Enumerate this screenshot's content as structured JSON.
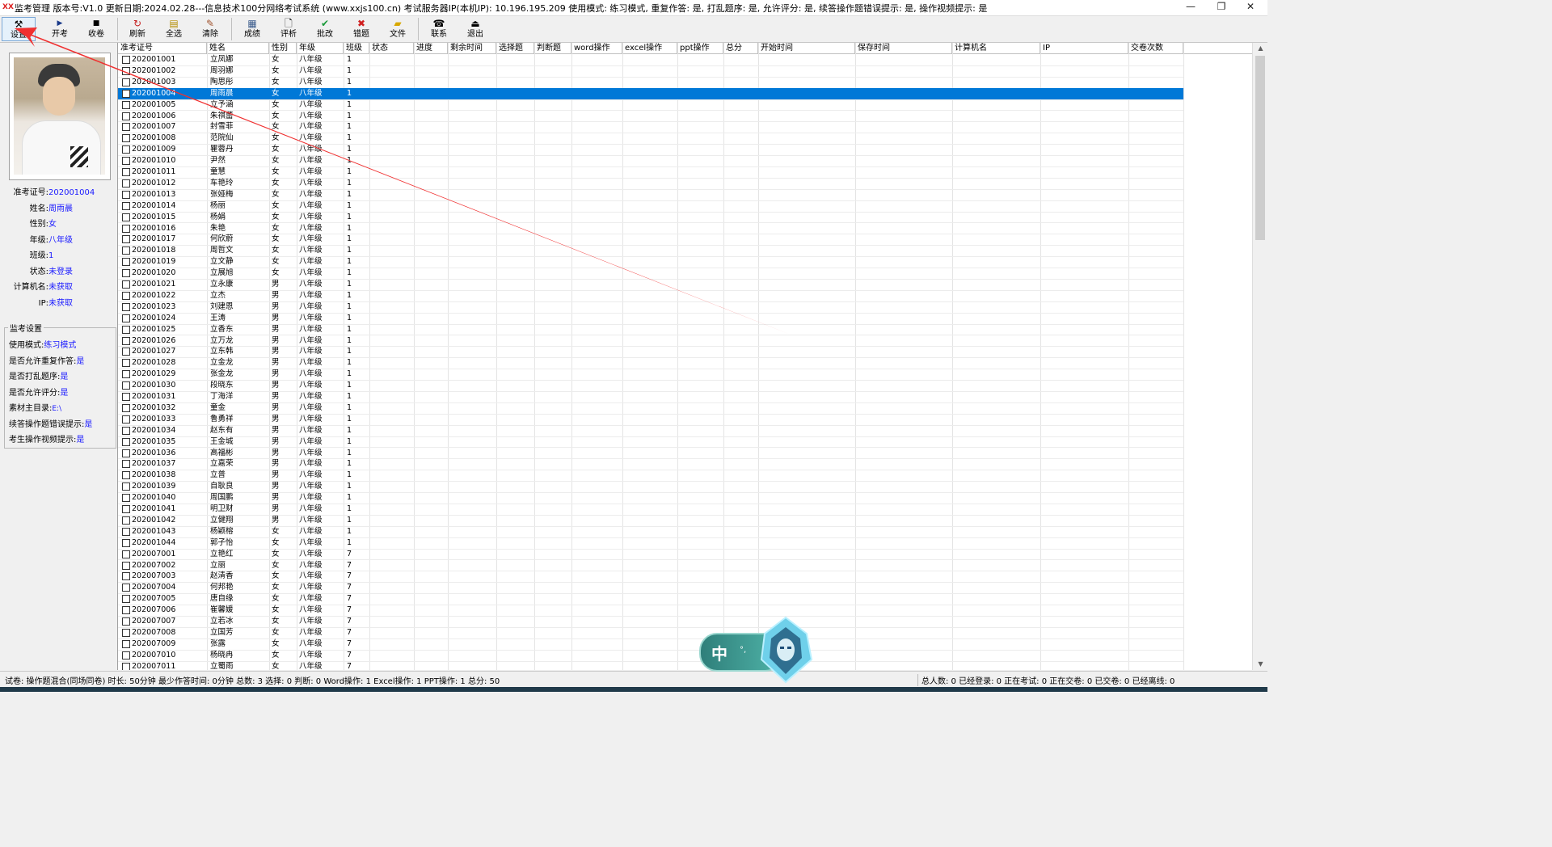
{
  "window": {
    "title": "监考管理 版本号:V1.0 更新日期:2024.02.28---信息技术100分网络考试系统    (www.xxjs100.cn)          考试服务器IP(本机IP): 10.196.195.209    使用模式: 练习模式, 重复作答: 是, 打乱题序: 是, 允许评分: 是, 续答操作题错误提示: 是, 操作视频提示: 是",
    "controls": [
      "—",
      "❐",
      "✕"
    ]
  },
  "toolbar": {
    "buttons": [
      {
        "label": "设置",
        "icon": "tools-icon"
      },
      {
        "label": "开考",
        "icon": "play-icon"
      },
      {
        "label": "收卷",
        "icon": "stop-icon"
      },
      {
        "label": "刷新",
        "icon": "refresh-icon"
      },
      {
        "label": "全选",
        "icon": "select-all-icon"
      },
      {
        "label": "清除",
        "icon": "eraser-icon"
      },
      {
        "label": "成绩",
        "icon": "scores-icon"
      },
      {
        "label": "评析",
        "icon": "analysis-icon"
      },
      {
        "label": "批改",
        "icon": "check-icon"
      },
      {
        "label": "错题",
        "icon": "wrong-icon"
      },
      {
        "label": "文件",
        "icon": "folder-icon"
      },
      {
        "label": "联系",
        "icon": "phone-icon"
      },
      {
        "label": "退出",
        "icon": "exit-icon"
      }
    ]
  },
  "student": {
    "fields": [
      {
        "key": "准考证号:",
        "value": "202001004"
      },
      {
        "key": "姓名:",
        "value": "周雨晨"
      },
      {
        "key": "性别:",
        "value": "女"
      },
      {
        "key": "年级:",
        "value": "八年级"
      },
      {
        "key": "班级:",
        "value": "1"
      },
      {
        "key": "状态:",
        "value": "未登录"
      },
      {
        "key": "计算机名:",
        "value": "未获取"
      },
      {
        "key": "IP:",
        "value": "未获取"
      }
    ]
  },
  "settings": {
    "title": "监考设置",
    "rows": [
      {
        "key": "使用模式:",
        "value": "练习模式"
      },
      {
        "key": "是否允许重复作答:",
        "value": "是"
      },
      {
        "key": "是否打乱题序:",
        "value": "是"
      },
      {
        "key": "是否允许评分:",
        "value": "是"
      },
      {
        "key": "素材主目录:",
        "value": "E:\\"
      },
      {
        "key": "续答操作题错误提示:",
        "value": "是"
      },
      {
        "key": "考生操作视频提示:",
        "value": "是"
      }
    ]
  },
  "grid": {
    "columns": [
      "准考证号",
      "姓名",
      "性别",
      "年级",
      "班级",
      "状态",
      "进度",
      "剩余时间",
      "选择题",
      "判断题",
      "word操作",
      "excel操作",
      "ppt操作",
      "总分",
      "开始时间",
      "保存时间",
      "计算机名",
      "IP",
      "交卷次数"
    ],
    "selected_index": 3,
    "rows": [
      [
        "202001001",
        "立凤娜",
        "女",
        "八年级",
        "1"
      ],
      [
        "202001002",
        "周羽娜",
        "女",
        "八年级",
        "1"
      ],
      [
        "202001003",
        "陶思彤",
        "女",
        "八年级",
        "1"
      ],
      [
        "202001004",
        "周雨晨",
        "女",
        "八年级",
        "1"
      ],
      [
        "202001005",
        "立予涵",
        "女",
        "八年级",
        "1"
      ],
      [
        "202001006",
        "朱祺蕾",
        "女",
        "八年级",
        "1"
      ],
      [
        "202001007",
        "封雪菲",
        "女",
        "八年级",
        "1"
      ],
      [
        "202001008",
        "范院仙",
        "女",
        "八年级",
        "1"
      ],
      [
        "202001009",
        "瞿蓉丹",
        "女",
        "八年级",
        "1"
      ],
      [
        "202001010",
        "尹然",
        "女",
        "八年级",
        "1"
      ],
      [
        "202001011",
        "童慧",
        "女",
        "八年级",
        "1"
      ],
      [
        "202001012",
        "车艳玲",
        "女",
        "八年级",
        "1"
      ],
      [
        "202001013",
        "张娅梅",
        "女",
        "八年级",
        "1"
      ],
      [
        "202001014",
        "杨丽",
        "女",
        "八年级",
        "1"
      ],
      [
        "202001015",
        "杨娟",
        "女",
        "八年级",
        "1"
      ],
      [
        "202001016",
        "朱艳",
        "女",
        "八年级",
        "1"
      ],
      [
        "202001017",
        "何欣蔚",
        "女",
        "八年级",
        "1"
      ],
      [
        "202001018",
        "周哲文",
        "女",
        "八年级",
        "1"
      ],
      [
        "202001019",
        "立文静",
        "女",
        "八年级",
        "1"
      ],
      [
        "202001020",
        "立展旭",
        "女",
        "八年级",
        "1"
      ],
      [
        "202001021",
        "立永康",
        "男",
        "八年级",
        "1"
      ],
      [
        "202001022",
        "立杰",
        "男",
        "八年级",
        "1"
      ],
      [
        "202001023",
        "刘建恩",
        "男",
        "八年级",
        "1"
      ],
      [
        "202001024",
        "王涛",
        "男",
        "八年级",
        "1"
      ],
      [
        "202001025",
        "立香东",
        "男",
        "八年级",
        "1"
      ],
      [
        "202001026",
        "立万龙",
        "男",
        "八年级",
        "1"
      ],
      [
        "202001027",
        "立东韩",
        "男",
        "八年级",
        "1"
      ],
      [
        "202001028",
        "立金龙",
        "男",
        "八年级",
        "1"
      ],
      [
        "202001029",
        "张金龙",
        "男",
        "八年级",
        "1"
      ],
      [
        "202001030",
        "段晓东",
        "男",
        "八年级",
        "1"
      ],
      [
        "202001031",
        "丁海洋",
        "男",
        "八年级",
        "1"
      ],
      [
        "202001032",
        "童金",
        "男",
        "八年级",
        "1"
      ],
      [
        "202001033",
        "鲁勇祥",
        "男",
        "八年级",
        "1"
      ],
      [
        "202001034",
        "赵东有",
        "男",
        "八年级",
        "1"
      ],
      [
        "202001035",
        "王金城",
        "男",
        "八年级",
        "1"
      ],
      [
        "202001036",
        "高福彬",
        "男",
        "八年级",
        "1"
      ],
      [
        "202001037",
        "立嘉荣",
        "男",
        "八年级",
        "1"
      ],
      [
        "202001038",
        "立普",
        "男",
        "八年级",
        "1"
      ],
      [
        "202001039",
        "自耿良",
        "男",
        "八年级",
        "1"
      ],
      [
        "202001040",
        "周国鹏",
        "男",
        "八年级",
        "1"
      ],
      [
        "202001041",
        "明卫财",
        "男",
        "八年级",
        "1"
      ],
      [
        "202001042",
        "立健翔",
        "男",
        "八年级",
        "1"
      ],
      [
        "202001043",
        "杨颖榕",
        "女",
        "八年级",
        "1"
      ],
      [
        "202001044",
        "郭子怡",
        "女",
        "八年级",
        "1"
      ],
      [
        "202007001",
        "立艳红",
        "女",
        "八年级",
        "7"
      ],
      [
        "202007002",
        "立丽",
        "女",
        "八年级",
        "7"
      ],
      [
        "202007003",
        "赵清香",
        "女",
        "八年级",
        "7"
      ],
      [
        "202007004",
        "何邦艳",
        "女",
        "八年级",
        "7"
      ],
      [
        "202007005",
        "唐自缘",
        "女",
        "八年级",
        "7"
      ],
      [
        "202007006",
        "崔馨媛",
        "女",
        "八年级",
        "7"
      ],
      [
        "202007007",
        "立若冰",
        "女",
        "八年级",
        "7"
      ],
      [
        "202007008",
        "立国芳",
        "女",
        "八年级",
        "7"
      ],
      [
        "202007009",
        "张露",
        "女",
        "八年级",
        "7"
      ],
      [
        "202007010",
        "杨晓冉",
        "女",
        "八年级",
        "7"
      ],
      [
        "202007011",
        "立蜀雨",
        "女",
        "八年级",
        "7"
      ]
    ]
  },
  "status": {
    "left": "试卷: 操作题混合(同场同卷) 时长: 50分钟 最少作答时间: 0分钟   总数: 3 选择: 0 判断: 0 Word操作: 1 Excel操作: 1 PPT操作: 1 总分: 50",
    "right": "总人数: 0 已经登录: 0 正在考试: 0 正在交卷: 0 已交卷: 0 已经离线: 0"
  },
  "ime": {
    "char": "中",
    "dots": "°,"
  }
}
